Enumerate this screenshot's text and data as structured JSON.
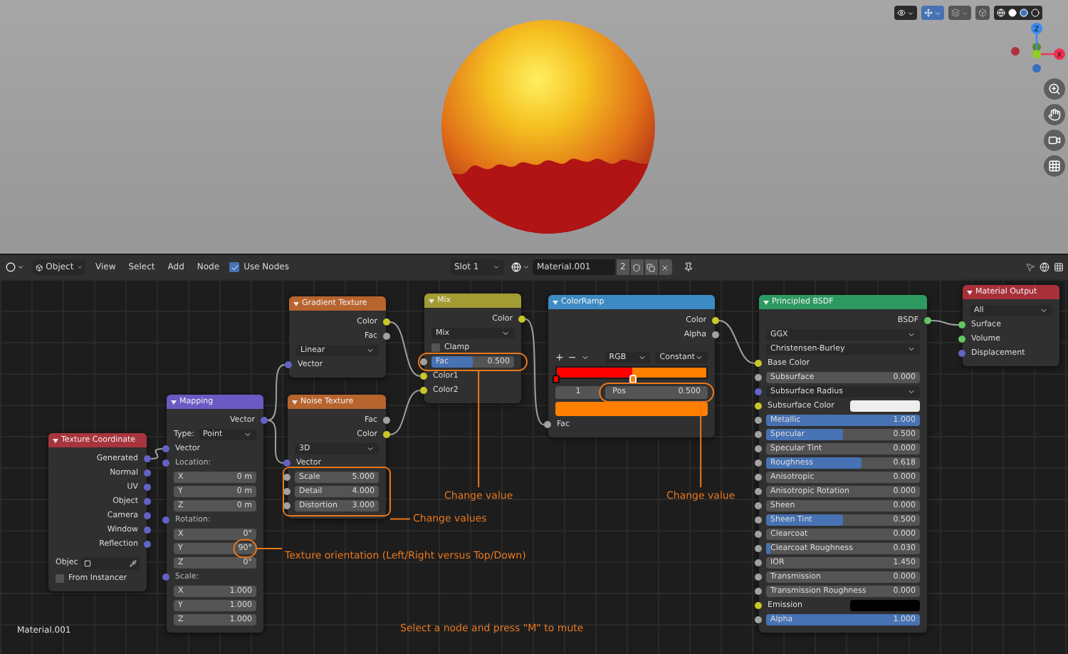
{
  "viewport": {
    "axes": [
      {
        "label": "Z"
      },
      {
        "label": "X"
      }
    ]
  },
  "header": {
    "mode": "Object",
    "menus": [
      "View",
      "Select",
      "Add",
      "Node"
    ],
    "use_nodes": {
      "label": "Use Nodes",
      "checked": true
    },
    "slot": "Slot 1",
    "material": "Material.001",
    "users": "2"
  },
  "nodes": [
    {
      "title": "Texture Coordinate",
      "color": "#a8353d",
      "rows": [
        {
          "kind": "output",
          "label": "Generated",
          "socket": {
            "color": "#6363c7"
          }
        },
        {
          "kind": "output",
          "label": "Normal",
          "socket": {
            "color": "#6363c7"
          }
        },
        {
          "kind": "output",
          "label": "UV",
          "socket": {
            "color": "#6363c7"
          }
        },
        {
          "kind": "output",
          "label": "Object",
          "socket": {
            "color": "#6363c7"
          }
        },
        {
          "kind": "output",
          "label": "Camera",
          "socket": {
            "color": "#6363c7"
          }
        },
        {
          "kind": "output",
          "label": "Window",
          "socket": {
            "color": "#6363c7"
          }
        },
        {
          "kind": "output",
          "label": "Reflection",
          "socket": {
            "color": "#6363c7"
          }
        },
        {
          "kind": "object",
          "label": "Objec"
        },
        {
          "kind": "checkbox",
          "label": "From Instancer",
          "checked": false
        }
      ]
    },
    {
      "title": "Mapping",
      "color": "#6c5ac4",
      "rows": [
        {
          "kind": "output",
          "label": "Vector",
          "socket": {
            "color": "#6363c7"
          }
        },
        {
          "kind": "labeled-dropdown",
          "label": "Type:",
          "value": "Point"
        },
        {
          "kind": "input",
          "label": "Vector",
          "socket": {
            "color": "#6363c7"
          }
        },
        {
          "kind": "label",
          "label": "Location:",
          "socket": {
            "color": "#6363c7"
          }
        },
        {
          "kind": "number",
          "label": "X",
          "value": "0 m"
        },
        {
          "kind": "number",
          "label": "Y",
          "value": "0 m"
        },
        {
          "kind": "number",
          "label": "Z",
          "value": "0 m"
        },
        {
          "kind": "label",
          "label": "Rotation:",
          "socket": {
            "color": "#6363c7"
          }
        },
        {
          "kind": "number",
          "label": "X",
          "value": "0°"
        },
        {
          "kind": "number",
          "label": "Y",
          "value": "90°"
        },
        {
          "kind": "number",
          "label": "Z",
          "value": "0°"
        },
        {
          "kind": "label",
          "label": "Scale:",
          "socket": {
            "color": "#6363c7"
          }
        },
        {
          "kind": "number",
          "label": "X",
          "value": "1.000"
        },
        {
          "kind": "number",
          "label": "Y",
          "value": "1.000"
        },
        {
          "kind": "number",
          "label": "Z",
          "value": "1.000"
        }
      ]
    },
    {
      "title": "Gradient Texture",
      "color": "#b8642e",
      "rows": [
        {
          "kind": "output",
          "label": "Color",
          "socket": {
            "color": "#c7c729"
          }
        },
        {
          "kind": "output",
          "label": "Fac",
          "socket": {
            "color": "#a1a1a1"
          }
        },
        {
          "kind": "dropdown",
          "value": "Linear"
        },
        {
          "kind": "input",
          "label": "Vector",
          "socket": {
            "color": "#6363c7"
          }
        }
      ]
    },
    {
      "title": "Noise Texture",
      "color": "#b8642e",
      "rows": [
        {
          "kind": "output",
          "label": "Fac",
          "socket": {
            "color": "#a1a1a1"
          }
        },
        {
          "kind": "output",
          "label": "Color",
          "socket": {
            "color": "#c7c729"
          }
        },
        {
          "kind": "dropdown",
          "value": "3D"
        },
        {
          "kind": "input",
          "label": "Vector",
          "socket": {
            "color": "#6363c7"
          }
        },
        {
          "kind": "number",
          "label": "Scale",
          "value": "5.000",
          "socket": {
            "color": "#a1a1a1"
          }
        },
        {
          "kind": "number",
          "label": "Detail",
          "value": "4.000",
          "socket": {
            "color": "#a1a1a1"
          }
        },
        {
          "kind": "number",
          "label": "Distortion",
          "value": "3.000",
          "socket": {
            "color": "#a1a1a1"
          }
        }
      ]
    },
    {
      "title": "Mix",
      "color": "#a39c32",
      "rows": [
        {
          "kind": "output",
          "label": "Color",
          "socket": {
            "color": "#c7c729"
          }
        },
        {
          "kind": "dropdown",
          "value": "Mix"
        },
        {
          "kind": "checkbox",
          "label": "Clamp",
          "checked": false
        },
        {
          "kind": "slider",
          "label": "Fac",
          "value": "0.500",
          "level": 0.5,
          "socket": {
            "color": "#a1a1a1"
          }
        },
        {
          "kind": "input",
          "label": "Color1",
          "socket": {
            "color": "#c7c729"
          }
        },
        {
          "kind": "input",
          "label": "Color2",
          "socket": {
            "color": "#c7c729"
          }
        }
      ]
    },
    {
      "title": "ColorRamp",
      "color": "#3d8bc4",
      "rows": [
        {
          "kind": "output",
          "label": "Color",
          "socket": {
            "color": "#c7c729"
          }
        },
        {
          "kind": "output",
          "label": "Alpha",
          "socket": {
            "color": "#a1a1a1"
          }
        },
        {
          "kind": "ramp-tools",
          "add": "+",
          "remove": "−",
          "mode": "RGB",
          "interpolation": "Constant"
        },
        {
          "kind": "ramp-bar",
          "stops": [
            {
              "level": 0,
              "color": "#ff0000",
              "selected": false
            },
            {
              "level": 0.5,
              "color": "#ff8000",
              "selected": true
            }
          ]
        },
        {
          "kind": "ramp-pos",
          "index": "1",
          "label": "Pos",
          "value": "0.500"
        },
        {
          "kind": "swatch",
          "color": "#ff8000"
        },
        {
          "kind": "input",
          "label": "Fac",
          "socket": {
            "color": "#a1a1a1"
          }
        }
      ]
    },
    {
      "title": "Principled BSDF",
      "color": "#2d9a62",
      "rows": [
        {
          "kind": "output",
          "label": "BSDF",
          "socket": {
            "color": "#63c763"
          }
        },
        {
          "kind": "dropdown",
          "value": "GGX"
        },
        {
          "kind": "dropdown",
          "value": "Christensen-Burley"
        },
        {
          "kind": "input",
          "label": "Base Color",
          "socket": {
            "color": "#c7c729"
          }
        },
        {
          "kind": "slider",
          "label": "Subsurface",
          "value": "0.000",
          "level": 0,
          "socket": {
            "color": "#a1a1a1"
          }
        },
        {
          "kind": "dropdown",
          "value": "Subsurface Radius",
          "socket": {
            "color": "#6363c7"
          }
        },
        {
          "kind": "color",
          "label": "Subsurface Color",
          "color": "#eeeeee",
          "socket": {
            "color": "#c7c729"
          }
        },
        {
          "kind": "slider",
          "label": "Metallic",
          "value": "1.000",
          "level": 1,
          "socket": {
            "color": "#a1a1a1"
          }
        },
        {
          "kind": "slider",
          "label": "Specular",
          "value": "0.500",
          "level": 0.5,
          "socket": {
            "color": "#a1a1a1"
          }
        },
        {
          "kind": "slider",
          "label": "Specular Tint",
          "value": "0.000",
          "level": 0,
          "socket": {
            "color": "#a1a1a1"
          }
        },
        {
          "kind": "slider",
          "label": "Roughness",
          "value": "0.618",
          "level": 0.618,
          "socket": {
            "color": "#a1a1a1"
          }
        },
        {
          "kind": "slider",
          "label": "Anisotropic",
          "value": "0.000",
          "level": 0,
          "socket": {
            "color": "#a1a1a1"
          }
        },
        {
          "kind": "slider",
          "label": "Anisotropic Rotation",
          "value": "0.000",
          "level": 0,
          "socket": {
            "color": "#a1a1a1"
          }
        },
        {
          "kind": "slider",
          "label": "Sheen",
          "value": "0.000",
          "level": 0,
          "socket": {
            "color": "#a1a1a1"
          }
        },
        {
          "kind": "slider",
          "label": "Sheen Tint",
          "value": "0.500",
          "level": 0.5,
          "socket": {
            "color": "#a1a1a1"
          }
        },
        {
          "kind": "slider",
          "label": "Clearcoat",
          "value": "0.000",
          "level": 0,
          "socket": {
            "color": "#a1a1a1"
          }
        },
        {
          "kind": "slider",
          "label": "Clearcoat Roughness",
          "value": "0.030",
          "level": 0.03,
          "socket": {
            "color": "#a1a1a1"
          }
        },
        {
          "kind": "number",
          "label": "IOR",
          "value": "1.450",
          "socket": {
            "color": "#a1a1a1"
          }
        },
        {
          "kind": "slider",
          "label": "Transmission",
          "value": "0.000",
          "level": 0,
          "socket": {
            "color": "#a1a1a1"
          }
        },
        {
          "kind": "slider",
          "label": "Transmission Roughness",
          "value": "0.000",
          "level": 0,
          "socket": {
            "color": "#a1a1a1"
          }
        },
        {
          "kind": "color",
          "label": "Emission",
          "color": "#000000",
          "socket": {
            "color": "#c7c729"
          }
        },
        {
          "kind": "slider",
          "label": "Alpha",
          "value": "1.000",
          "level": 1,
          "socket": {
            "color": "#a1a1a1"
          }
        }
      ]
    },
    {
      "title": "Material Output",
      "color": "#a8303a",
      "rows": [
        {
          "kind": "dropdown",
          "value": "All"
        },
        {
          "kind": "input",
          "label": "Surface",
          "socket": {
            "color": "#63c763"
          }
        },
        {
          "kind": "input",
          "label": "Volume",
          "socket": {
            "color": "#63c763"
          }
        },
        {
          "kind": "input",
          "label": "Displacement",
          "socket": {
            "color": "#6363c7"
          }
        }
      ]
    }
  ],
  "annotations": [
    "Texture orientation (Left/Right versus Top/Down)",
    "Change values",
    "Change value",
    "Change value",
    "Select a node and press \"M\" to mute"
  ],
  "material_label": "Material.001"
}
